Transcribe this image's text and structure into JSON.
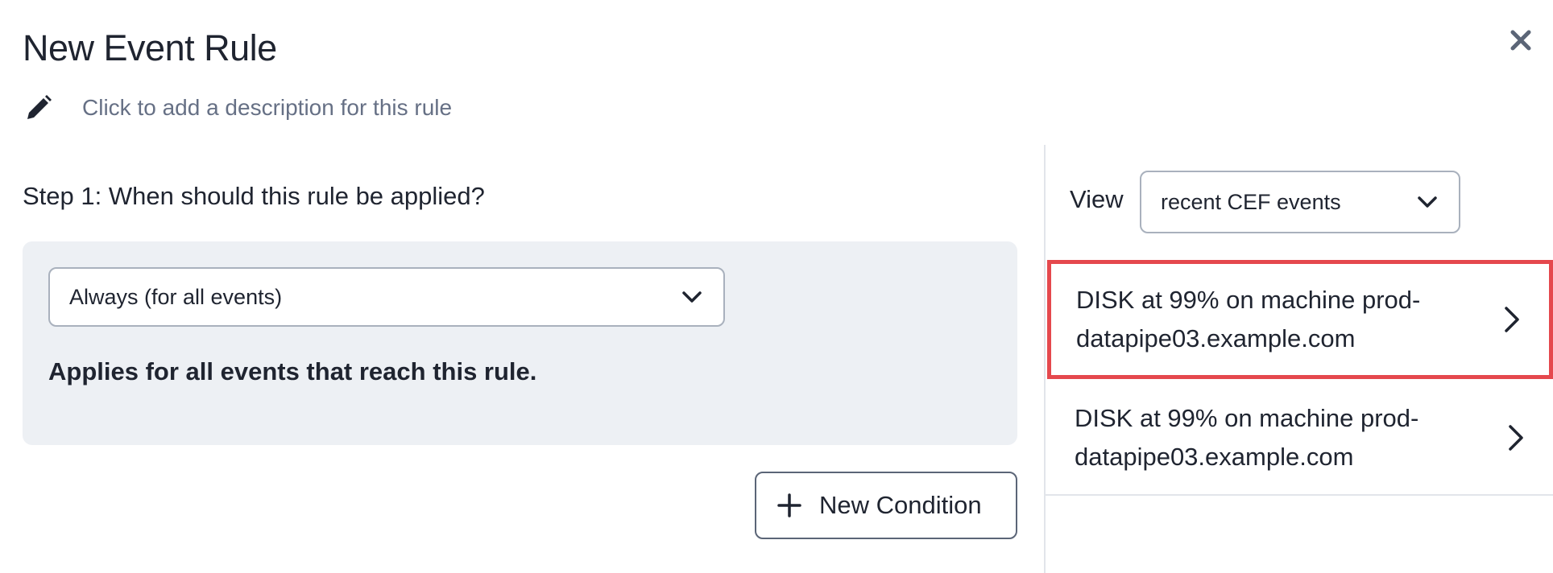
{
  "dialog": {
    "title": "New Event Rule",
    "description_placeholder": "Click to add a description for this rule",
    "close_icon": "close-icon",
    "edit_icon": "pencil-icon"
  },
  "step1": {
    "title": "Step 1: When should this rule be applied?",
    "condition_select": {
      "value": "Always (for all events)",
      "icon": "chevron-down-icon"
    },
    "applies_text": "Applies for all events that reach this rule.",
    "new_condition_button": {
      "label": "New Condition",
      "icon": "plus-icon"
    }
  },
  "side_panel": {
    "view_label": "View",
    "view_select": {
      "value": "recent CEF events",
      "icon": "chevron-down-icon"
    },
    "events": [
      {
        "text": "DISK at 99% on machine prod-\ndatapipe03.example.com",
        "selected": true,
        "icon": "chevron-right-icon"
      },
      {
        "text": "DISK at 99% on machine prod-\ndatapipe03.example.com",
        "selected": false,
        "icon": "chevron-right-icon"
      }
    ]
  },
  "colors": {
    "highlight_border": "#e5484d",
    "condition_panel_bg": "#edf0f4",
    "muted_text": "#667085"
  }
}
